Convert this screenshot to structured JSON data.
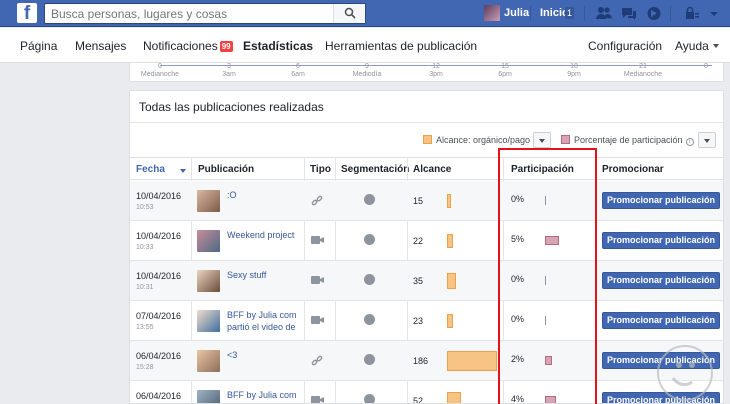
{
  "topbar": {
    "logo": "f",
    "search_placeholder": "Busca personas, lugares y cosas",
    "user_name": "Julia",
    "home_label": "Inicio",
    "home_count": "1",
    "icons": [
      "friends-icon",
      "messages-icon",
      "globe-icon",
      "privacy-icon",
      "chevron-down-icon"
    ]
  },
  "page_nav": {
    "items": [
      {
        "label": "Página"
      },
      {
        "label": "Mensajes"
      },
      {
        "label": "Notificaciones",
        "badge": "99"
      },
      {
        "label": "Estadísticas",
        "active": true
      },
      {
        "label": "Herramientas de publicación"
      },
      {
        "label": "Configuración"
      },
      {
        "label": "Ayuda"
      }
    ]
  },
  "timeline": {
    "ticks": [
      "0",
      "3",
      "6",
      "9",
      "12",
      "15",
      "18",
      "21",
      "0"
    ],
    "labels": [
      "Medianoche",
      "3am",
      "6am",
      "Mediodía",
      "3pm",
      "6pm",
      "9pm",
      "Medianoche"
    ]
  },
  "posts_card": {
    "title": "Todas las publicaciones realizadas",
    "legend": {
      "reach_label": "Alcance: orgánico/pago",
      "reach_color": "#f7c484",
      "engagement_label": "Porcentaje de participación",
      "engagement_color": "#d7a4b1"
    },
    "columns": {
      "date": "Fecha",
      "post": "Publicación",
      "type": "Tipo",
      "targeting": "Segmentación",
      "reach": "Alcance",
      "engagement": "Participación",
      "promote": "Promocionar"
    },
    "rows": [
      {
        "date": "10/04/2016",
        "time": "10:53",
        "title": ":O",
        "type": "link-icon",
        "reach": "15",
        "reach_val": 15,
        "engagement": "0%",
        "engagement_val": 0,
        "promote": "Promocionar publicación"
      },
      {
        "date": "10/04/2016",
        "time": "10:33",
        "title": "Weekend project",
        "type": "video-icon",
        "reach": "22",
        "reach_val": 22,
        "engagement": "5%",
        "engagement_val": 5,
        "promote": "Promocionar publicación"
      },
      {
        "date": "10/04/2016",
        "time": "10:31",
        "title": "Sexy stuff",
        "type": "video-icon",
        "reach": "35",
        "reach_val": 35,
        "engagement": "0%",
        "engagement_val": 0,
        "promote": "Promocionar publicación"
      },
      {
        "date": "07/04/2016",
        "time": "13:55",
        "title": "BFF by Julia com partió el video de",
        "type": "video-icon",
        "reach": "23",
        "reach_val": 23,
        "engagement": "0%",
        "engagement_val": 0,
        "promote": "Promocionar publicación"
      },
      {
        "date": "06/04/2016",
        "time": "15:28",
        "title": "<3",
        "type": "link-icon",
        "reach": "186",
        "reach_val": 186,
        "engagement": "2%",
        "engagement_val": 2,
        "promote": "Promocionar publicación"
      },
      {
        "date": "06/04/2016",
        "time": "",
        "title": "BFF by Julia com",
        "type": "video-icon",
        "reach": "52",
        "reach_val": 52,
        "engagement": "4%",
        "engagement_val": 4,
        "promote": "Promocionar publicación"
      }
    ]
  }
}
